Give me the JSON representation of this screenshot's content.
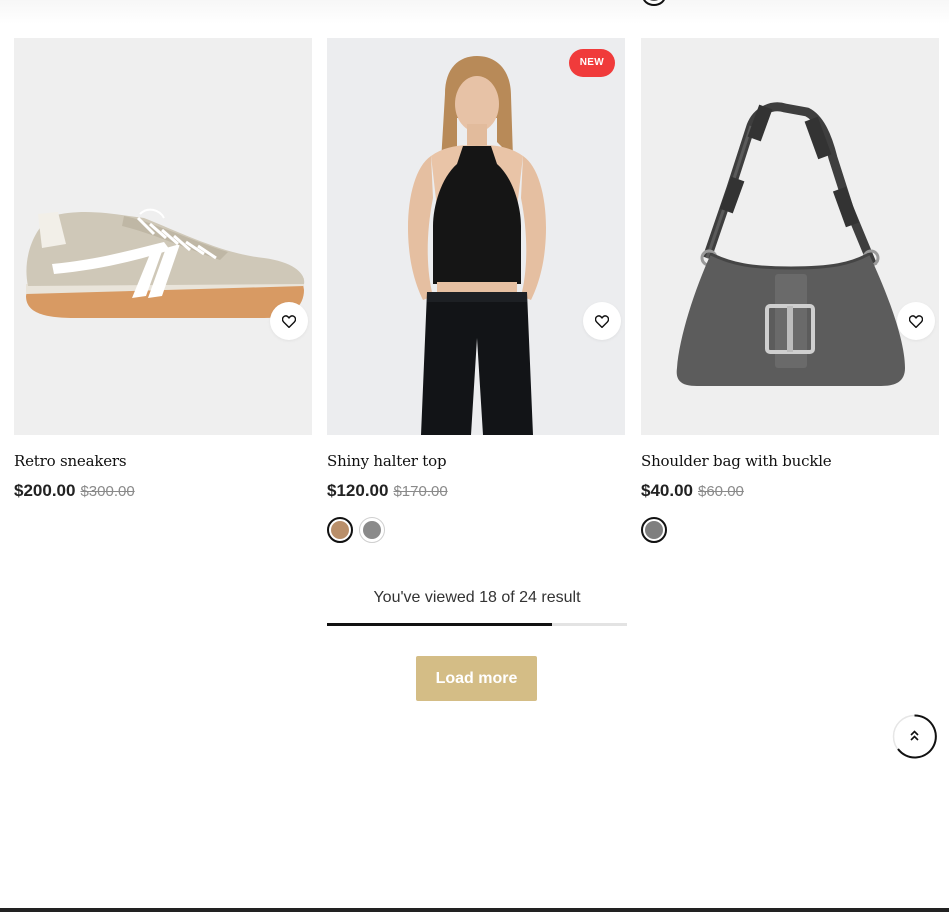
{
  "products": [
    {
      "title": "Retro sneakers",
      "price": "$200.00",
      "compare_price": "$300.00",
      "image_icon": "sneaker-image",
      "badge": "",
      "swatches": []
    },
    {
      "title": "Shiny halter top",
      "price": "$120.00",
      "compare_price": "$170.00",
      "image_icon": "model-halter-top-image",
      "badge": "NEW",
      "swatches": [
        {
          "name": "swatch-photo",
          "color": "#b98f6a",
          "active": true
        },
        {
          "name": "swatch-grey",
          "color": "#8a8a8a",
          "active": false
        }
      ]
    },
    {
      "title": "Shoulder bag with buckle",
      "price": "$40.00",
      "compare_price": "$60.00",
      "image_icon": "shoulder-bag-image",
      "badge": "",
      "swatches": [
        {
          "name": "swatch-grey",
          "color": "#7f7f7f",
          "active": true
        }
      ]
    }
  ],
  "pagination": {
    "viewed_text": "You've viewed 18 of 24 result",
    "viewed": 18,
    "total": 24,
    "load_more_label": "Load more"
  },
  "colors": {
    "badge": "#f03b3b",
    "load_more": "#d4bd86",
    "progress_fill": "#111111",
    "progress_track": "#e3e3e3"
  },
  "icons": {
    "wishlist": "heart-icon",
    "back_to_top": "double-chevron-up-icon"
  }
}
